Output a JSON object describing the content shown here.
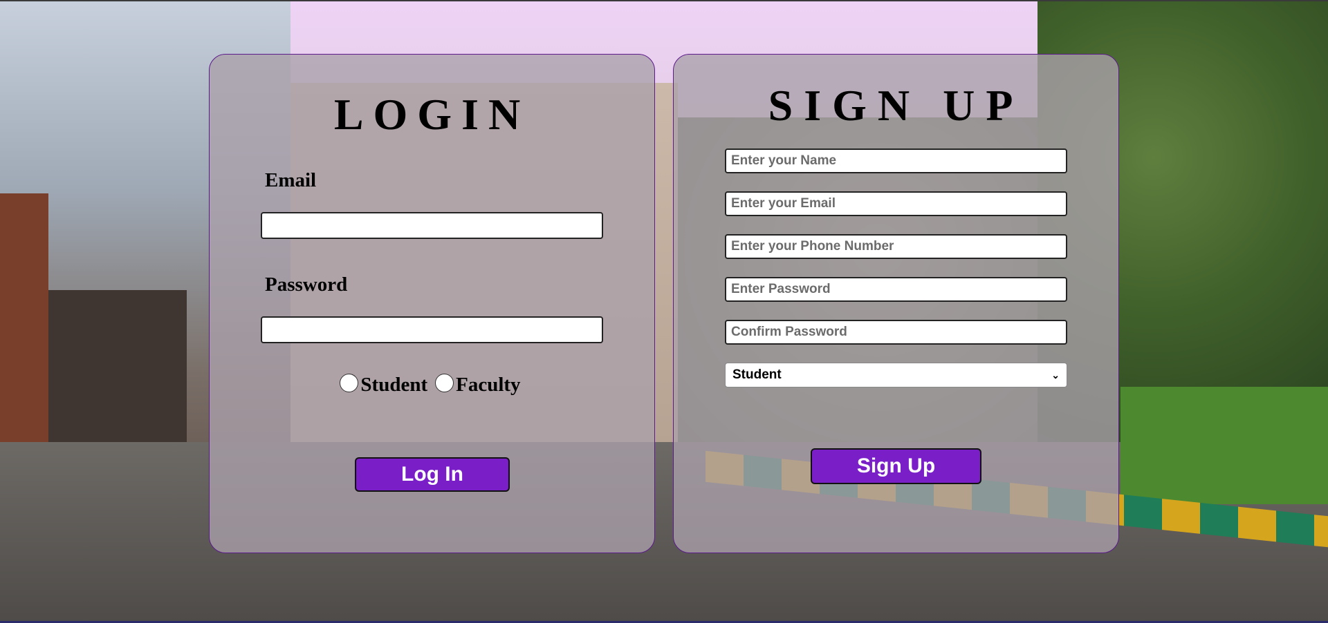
{
  "login": {
    "title": "LOGIN",
    "email_label": "Email",
    "email_value": "",
    "password_label": "Password",
    "password_value": "",
    "roles": [
      "Student",
      "Faculty"
    ],
    "button_label": "Log In"
  },
  "signup": {
    "title": "SIGN UP",
    "name_placeholder": "Enter your Name",
    "email_placeholder": "Enter your Email",
    "phone_placeholder": "Enter your Phone Number",
    "password_placeholder": "Enter Password",
    "confirm_placeholder": "Confirm Password",
    "role_selected": "Student",
    "button_label": "Sign Up"
  },
  "colors": {
    "accent": "#7a1fc8",
    "panel_border": "#5b1a8a"
  },
  "icons": {
    "select_chevron": "chevron-down-icon"
  }
}
